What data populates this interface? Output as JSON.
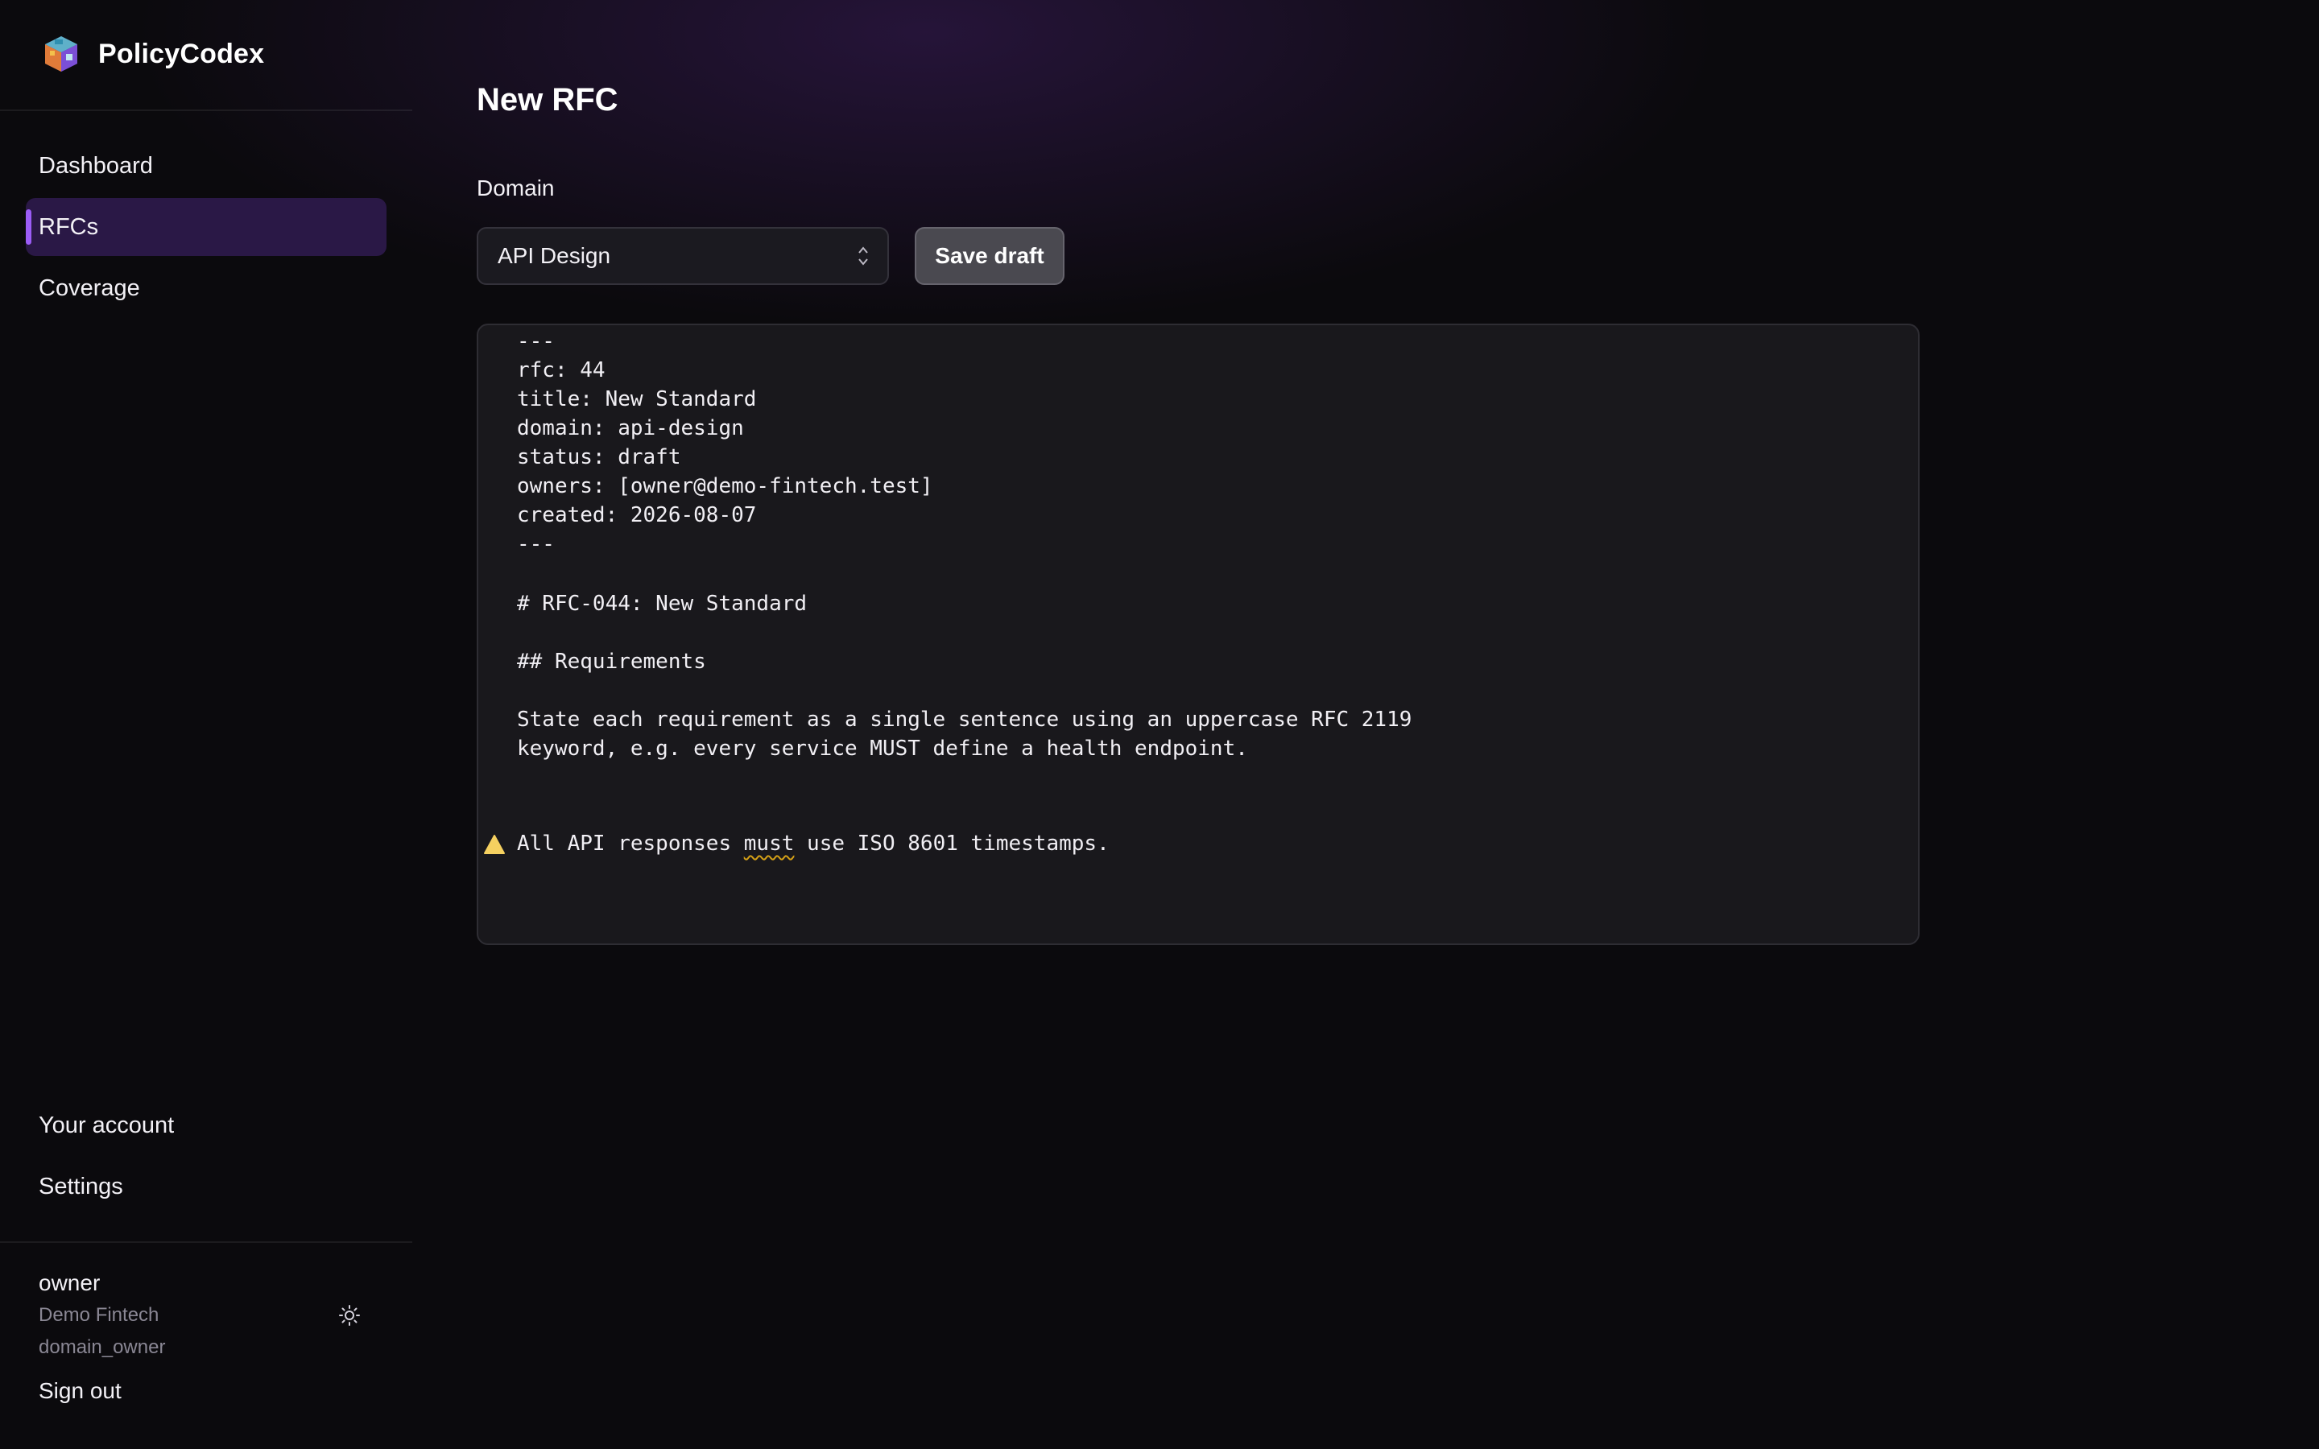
{
  "brand": {
    "name": "PolicyCodex"
  },
  "sidebar": {
    "nav": [
      {
        "label": "Dashboard"
      },
      {
        "label": "RFCs",
        "active": true
      },
      {
        "label": "Coverage"
      }
    ],
    "bottom_nav": [
      {
        "label": "Your account"
      },
      {
        "label": "Settings"
      }
    ],
    "user": {
      "name": "owner",
      "org": "Demo Fintech",
      "role": "domain_owner",
      "theme_toggle_icon": "sun-icon",
      "sign_out": "Sign out"
    }
  },
  "main": {
    "title": "New RFC",
    "domain_label": "Domain",
    "domain_selected": "API Design",
    "save_label": "Save draft",
    "editor": {
      "lines": [
        "---",
        "rfc: 44",
        "title: New Standard",
        "domain: api-design",
        "status: draft",
        "owners: [owner@demo-fintech.test]",
        "created: 2026-08-07",
        "---",
        "# RFC-044: New Standard",
        "## Requirements",
        "State each requirement as a single sentence using an uppercase RFC 2119",
        "keyword, e.g. every service MUST define a health endpoint."
      ],
      "warning_line": {
        "before": "All API responses ",
        "flagged": "must",
        "after": " use ISO 8601 timestamps."
      },
      "warning_icon": "warning-icon"
    }
  },
  "colors": {
    "accent": "#9b5cf6",
    "active_nav_bg": "#2a1846",
    "warning": "#f5d060"
  }
}
